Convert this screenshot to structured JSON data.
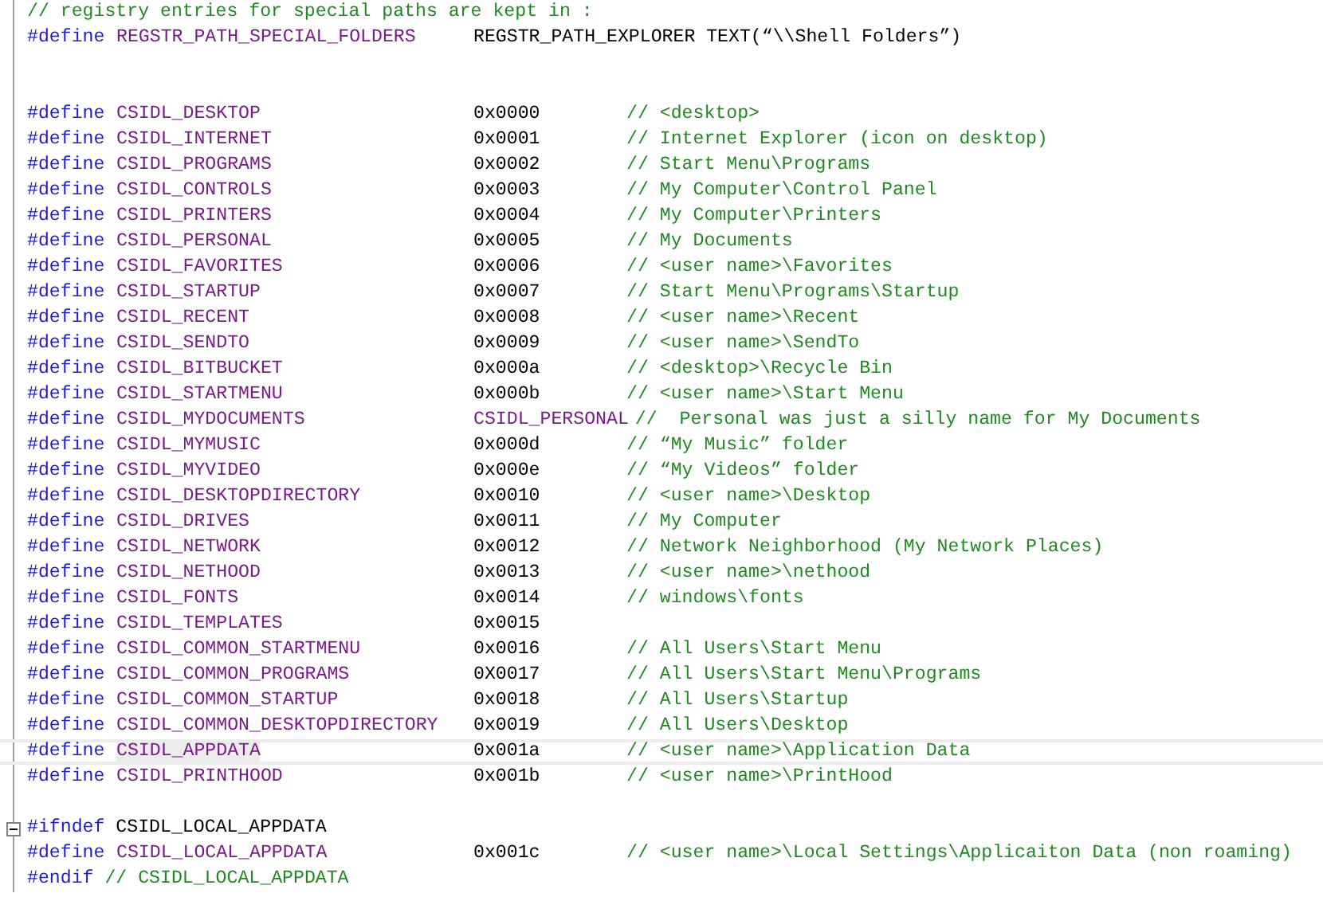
{
  "lines": [
    {
      "kind": "comment",
      "comment": "// registry entries for special paths are kept in :"
    },
    {
      "kind": "define",
      "keyword": "#define",
      "name": "REGSTR_PATH_SPECIAL_FOLDERS",
      "value": "REGSTR_PATH_EXPLORER TEXT(“\\\\Shell Folders”)"
    },
    {
      "kind": "blank"
    },
    {
      "kind": "blank"
    },
    {
      "kind": "define",
      "keyword": "#define",
      "name": "CSIDL_DESKTOP",
      "value": "0x0000",
      "comment": "// <desktop>"
    },
    {
      "kind": "define",
      "keyword": "#define",
      "name": "CSIDL_INTERNET",
      "value": "0x0001",
      "comment": "// Internet Explorer (icon on desktop)"
    },
    {
      "kind": "define",
      "keyword": "#define",
      "name": "CSIDL_PROGRAMS",
      "value": "0x0002",
      "comment": "// Start Menu\\Programs"
    },
    {
      "kind": "define",
      "keyword": "#define",
      "name": "CSIDL_CONTROLS",
      "value": "0x0003",
      "comment": "// My Computer\\Control Panel"
    },
    {
      "kind": "define",
      "keyword": "#define",
      "name": "CSIDL_PRINTERS",
      "value": "0x0004",
      "comment": "// My Computer\\Printers"
    },
    {
      "kind": "define",
      "keyword": "#define",
      "name": "CSIDL_PERSONAL",
      "value": "0x0005",
      "comment": "// My Documents"
    },
    {
      "kind": "define",
      "keyword": "#define",
      "name": "CSIDL_FAVORITES",
      "value": "0x0006",
      "comment": "// <user name>\\Favorites"
    },
    {
      "kind": "define",
      "keyword": "#define",
      "name": "CSIDL_STARTUP",
      "value": "0x0007",
      "comment": "// Start Menu\\Programs\\Startup"
    },
    {
      "kind": "define",
      "keyword": "#define",
      "name": "CSIDL_RECENT",
      "value": "0x0008",
      "comment": "// <user name>\\Recent"
    },
    {
      "kind": "define",
      "keyword": "#define",
      "name": "CSIDL_SENDTO",
      "value": "0x0009",
      "comment": "// <user name>\\SendTo"
    },
    {
      "kind": "define",
      "keyword": "#define",
      "name": "CSIDL_BITBUCKET",
      "value": "0x000a",
      "comment": "// <desktop>\\Recycle Bin"
    },
    {
      "kind": "define",
      "keyword": "#define",
      "name": "CSIDL_STARTMENU",
      "value": "0x000b",
      "comment": "// <user name>\\Start Menu"
    },
    {
      "kind": "define",
      "keyword": "#define",
      "name": "CSIDL_MYDOCUMENTS",
      "value": "CSIDL_PERSONAL",
      "value_is_macro": true,
      "comment": "//  Personal was just a silly name for My Documents"
    },
    {
      "kind": "define",
      "keyword": "#define",
      "name": "CSIDL_MYMUSIC",
      "value": "0x000d",
      "comment": "// “My Music” folder"
    },
    {
      "kind": "define",
      "keyword": "#define",
      "name": "CSIDL_MYVIDEO",
      "value": "0x000e",
      "comment": "// “My Videos” folder"
    },
    {
      "kind": "define",
      "keyword": "#define",
      "name": "CSIDL_DESKTOPDIRECTORY",
      "value": "0x0010",
      "comment": "// <user name>\\Desktop"
    },
    {
      "kind": "define",
      "keyword": "#define",
      "name": "CSIDL_DRIVES",
      "value": "0x0011",
      "comment": "// My Computer"
    },
    {
      "kind": "define",
      "keyword": "#define",
      "name": "CSIDL_NETWORK",
      "value": "0x0012",
      "comment": "// Network Neighborhood (My Network Places)"
    },
    {
      "kind": "define",
      "keyword": "#define",
      "name": "CSIDL_NETHOOD",
      "value": "0x0013",
      "comment": "// <user name>\\nethood"
    },
    {
      "kind": "define",
      "keyword": "#define",
      "name": "CSIDL_FONTS",
      "value": "0x0014",
      "comment": "// windows\\fonts"
    },
    {
      "kind": "define",
      "keyword": "#define",
      "name": "CSIDL_TEMPLATES",
      "value": "0x0015"
    },
    {
      "kind": "define",
      "keyword": "#define",
      "name": "CSIDL_COMMON_STARTMENU",
      "value": "0x0016",
      "comment": "// All Users\\Start Menu"
    },
    {
      "kind": "define",
      "keyword": "#define",
      "name": "CSIDL_COMMON_PROGRAMS",
      "value": "0X0017",
      "comment": "// All Users\\Start Menu\\Programs"
    },
    {
      "kind": "define",
      "keyword": "#define",
      "name": "CSIDL_COMMON_STARTUP",
      "value": "0x0018",
      "comment": "// All Users\\Startup"
    },
    {
      "kind": "define",
      "keyword": "#define",
      "name": "CSIDL_COMMON_DESKTOPDIRECTORY",
      "value": "0x0019",
      "comment": "// All Users\\Desktop"
    },
    {
      "kind": "define",
      "keyword": "#define",
      "name": "CSIDL_APPDATA",
      "value": "0x001a",
      "comment": "// <user name>\\Application Data",
      "current": true
    },
    {
      "kind": "define",
      "keyword": "#define",
      "name": "CSIDL_PRINTHOOD",
      "value": "0x001b",
      "comment": "// <user name>\\PrintHood"
    },
    {
      "kind": "blank"
    },
    {
      "kind": "ifndef",
      "keyword": "#ifndef",
      "name": "CSIDL_LOCAL_APPDATA",
      "expanded": true
    },
    {
      "kind": "define",
      "keyword": "#define",
      "name": "CSIDL_LOCAL_APPDATA",
      "value": "0x001c",
      "comment": "// <user name>\\Local Settings\\Applicaiton Data (non roaming)"
    },
    {
      "kind": "endif",
      "keyword": "#endif",
      "comment": "// CSIDL_LOCAL_APPDATA"
    }
  ]
}
